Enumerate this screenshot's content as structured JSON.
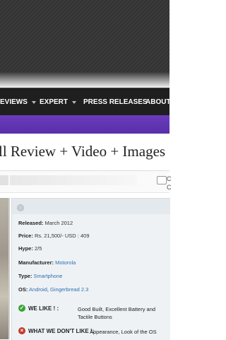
{
  "nav": {
    "items": [
      {
        "label": "EVIEWS",
        "has_caret": true
      },
      {
        "label": "EXPERT",
        "has_caret": true
      },
      {
        "label": "PRESS RELEASES",
        "has_caret": false
      },
      {
        "label": "ABOUT US",
        "has_caret": false
      }
    ]
  },
  "article": {
    "title": "ll Review + Video + Images",
    "comment_text_1": "C",
    "comment_text_2": "C"
  },
  "specs": {
    "released_label": "Released:",
    "released_value": "March 2012",
    "price_label": "Price:",
    "price_value": "Rs. 21,500/- USD : 409",
    "hype_label": "Hype:",
    "hype_value": "2/5",
    "manufacturer_label": "Manufacturer:",
    "manufacturer_value": "Motorola",
    "type_label": "Type:",
    "type_value": "Smartphone",
    "os_label": "OS:",
    "os_value_1": "Android",
    "os_value_2": "Gingerbread 2.3",
    "like_label": "WE LIKE ! :",
    "like_text": "Good Built, Excellent Battery and Tactile Buttons",
    "dislike_label": "WHAT WE DON'T LIKE !:",
    "dislike_text": "Appearance, Look of the OS"
  },
  "colors": {
    "nav_bg": "#1f1f1f",
    "accent_purple": "#5a2fa8",
    "link": "#2f6fb0",
    "like_green": "#3aa335",
    "dislike_red": "#c0392b"
  }
}
